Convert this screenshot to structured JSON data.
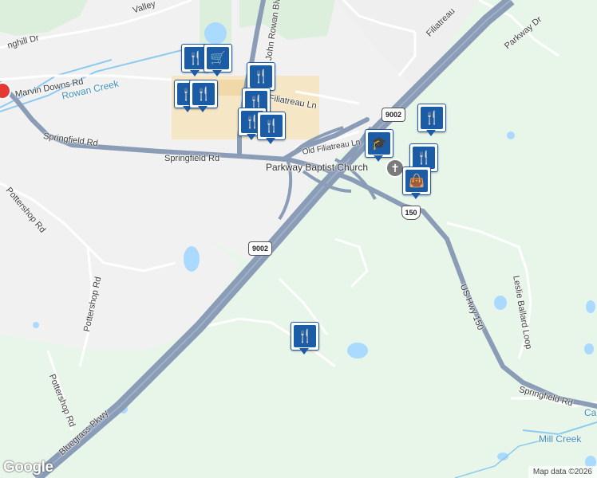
{
  "map": {
    "roads": {
      "springfield_rd_w": "Springfield Rd",
      "springfield_rd_e": "Springfield Rd",
      "marvin_downs": "Marvin Downs Rd",
      "pottershop_1": "Pottershop Rd",
      "pottershop_2": "Pottershop Rd",
      "pottershop_3": "Pottershop Rd",
      "john_rowan": "John Rowan Blvd",
      "filiatreau": "Filiatreau Ln",
      "filiatreau_n": "Filiatreau",
      "old_filiatreau": "Old Filiatreau Ln",
      "parkway_dr": "Parkway Dr",
      "leslie_ballard": "Leslie Ballard Loop",
      "us_hwy_150": "US Hwy 150",
      "bluegrass_pkwy": "Bluegrass Pkwy",
      "valley": "Valley",
      "hill_dr": "nghill Dr"
    },
    "water": {
      "rowan_creek": "Rowan Creek",
      "mill_creek": "Mill Creek",
      "edge_ca": "Ca"
    },
    "poi": {
      "church": "Parkway Baptist Church"
    },
    "shields": {
      "route_9002_a": "9002",
      "route_9002_b": "9002",
      "us_150": "150"
    },
    "markers": [
      {
        "icon": "restaurant-icon",
        "glyph": "🍴"
      },
      {
        "icon": "shopping-cart-icon",
        "glyph": "🛒"
      },
      {
        "icon": "restaurant-icon",
        "glyph": "🍴"
      },
      {
        "icon": "restaurant-icon",
        "glyph": "🍴"
      },
      {
        "icon": "restaurant-icon",
        "glyph": "🍴"
      },
      {
        "icon": "restaurant-icon",
        "glyph": "🍴"
      },
      {
        "icon": "restaurant-icon",
        "glyph": "🍴"
      },
      {
        "icon": "restaurant-icon",
        "glyph": "🍴"
      },
      {
        "icon": "school-icon",
        "glyph": "🎓"
      },
      {
        "icon": "restaurant-icon",
        "glyph": "🍴"
      },
      {
        "icon": "restaurant-icon",
        "glyph": "🍴"
      },
      {
        "icon": "shopping-bag-icon",
        "glyph": "👜"
      },
      {
        "icon": "restaurant-icon",
        "glyph": "🍴"
      }
    ],
    "logo": "Google",
    "attribution": "Map data ©2026"
  }
}
